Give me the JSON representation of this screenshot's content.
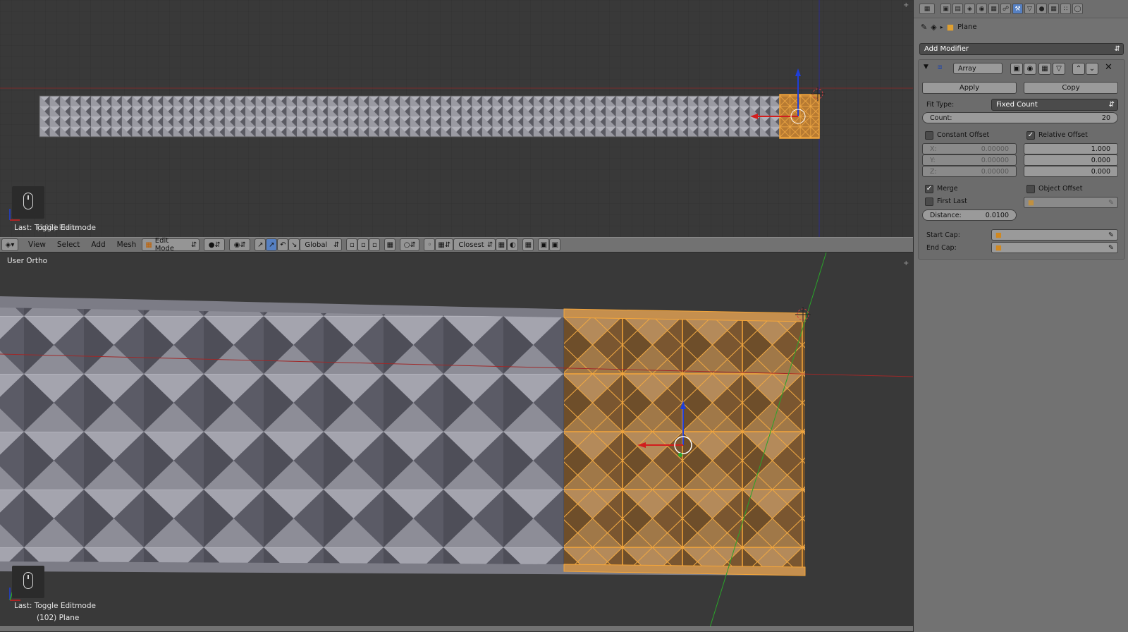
{
  "top_viewport": {
    "overlay_last_op": "Last: Toggle Editmode",
    "overlay_last_op_ghost": "(102) Plane"
  },
  "header": {
    "menus": [
      "View",
      "Select",
      "Add",
      "Mesh"
    ],
    "mode": "Edit Mode",
    "orientation": "Global",
    "snap_target": "Closest"
  },
  "bottom_viewport": {
    "view_label": "User Ortho",
    "overlay_last_op": "Last: Toggle Editmode",
    "object_info": "(102) Plane"
  },
  "properties": {
    "breadcrumb_object": "Plane",
    "add_modifier_label": "Add Modifier",
    "modifier": {
      "name": "Array",
      "apply_label": "Apply",
      "copy_label": "Copy",
      "fit_type_label": "Fit Type:",
      "fit_type_value": "Fixed Count",
      "count_label": "Count:",
      "count_value": "20",
      "constant_offset_label": "Constant Offset",
      "constant_offset_checked": false,
      "relative_offset_label": "Relative Offset",
      "relative_offset_checked": true,
      "constant_x_label": "X:",
      "constant_x": "0.00000",
      "constant_y_label": "Y:",
      "constant_y": "0.00000",
      "constant_z_label": "Z:",
      "constant_z": "0.00000",
      "relative_x": "1.000",
      "relative_y": "0.000",
      "relative_z": "0.000",
      "merge_label": "Merge",
      "merge_checked": true,
      "first_last_label": "First Last",
      "first_last_checked": false,
      "object_offset_label": "Object Offset",
      "object_offset_checked": false,
      "distance_label": "Distance:",
      "distance_value": "0.0100",
      "start_cap_label": "Start Cap:",
      "end_cap_label": "End Cap:"
    }
  },
  "colors": {
    "selection_orange": "#e8a850",
    "mesh_gray": "#8d8d97",
    "axis_red": "#d21d1d",
    "axis_blue": "#1f3fd8",
    "axis_green": "#2aa42a"
  }
}
